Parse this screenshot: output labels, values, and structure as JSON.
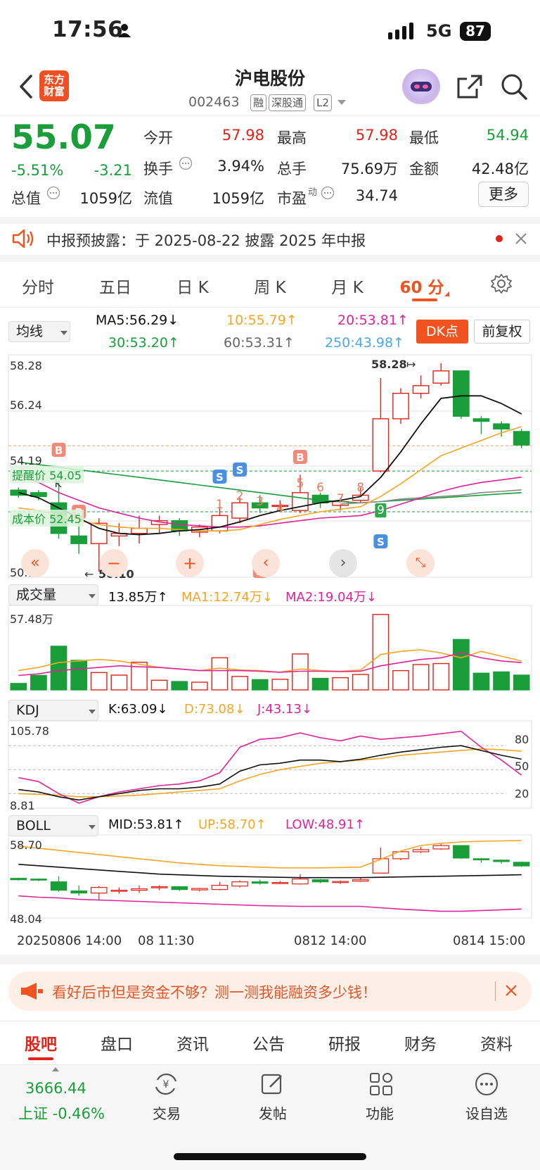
{
  "status": {
    "time": "17:56",
    "network": "5G",
    "battery": "87"
  },
  "header": {
    "title": "沪电股份",
    "code": "002463",
    "tags": [
      "融",
      "深股通",
      "L2"
    ],
    "logo_text": "东方财富"
  },
  "quote": {
    "price": "55.07",
    "change_pct": "-5.51%",
    "change": "-3.21",
    "stats": [
      {
        "label": "今开",
        "value": "57.98",
        "color": "red"
      },
      {
        "label": "最高",
        "value": "57.98",
        "color": "red"
      },
      {
        "label": "最低",
        "value": "54.94",
        "color": "green"
      },
      {
        "label": "换手",
        "value": "3.94%",
        "color": "normal"
      },
      {
        "label": "总手",
        "value": "75.69万",
        "color": "normal"
      },
      {
        "label": "金额",
        "value": "42.48亿",
        "color": "normal"
      },
      {
        "label": "总值",
        "value": "1059亿",
        "color": "normal"
      },
      {
        "label": "流值",
        "value": "1059亿",
        "color": "normal"
      },
      {
        "label": "市盈",
        "sup": "动",
        "value": "34.74",
        "color": "normal"
      }
    ],
    "more": "更多"
  },
  "notice": {
    "text": "中报预披露：于 2025-08-22 披露 2025 年中报"
  },
  "period_tabs": [
    "分时",
    "五日",
    "日 K",
    "周 K",
    "月 K",
    "60 分"
  ],
  "active_period": "60 分",
  "ma_row": {
    "select": "均线",
    "ma5": "MA5:56.29↓",
    "ma10": "10:55.79↑",
    "ma20": "20:53.81↑",
    "ma30": "30:53.20↑",
    "ma60": "60:53.31↑",
    "ma250": "250:43.98↑",
    "dk_button": "DK点",
    "adjust_button": "前复权"
  },
  "colors": {
    "up": "#e2231a",
    "down": "#1a9e3a",
    "accent": "#f0531f",
    "ma5": "#111111",
    "ma10": "#f5a623",
    "ma20": "#e0239a",
    "ma30": "#1a9e3a",
    "ma60": "#888888",
    "ma250": "#4aa8ee"
  },
  "kline": {
    "axis": [
      "58.28",
      "56.24",
      "54.19",
      "50.10"
    ],
    "high_mark": "58.28",
    "low_mark": "50.10",
    "alert_price": "提醒价 54.05",
    "cost_price": "成本价 52.45",
    "signal_numbers": [
      "1",
      "2",
      "3",
      "4",
      "5",
      "6",
      "7",
      "8",
      "9"
    ],
    "signal_b": "B",
    "signal_s": "S",
    "signal_k": "K"
  },
  "volume": {
    "select": "成交量",
    "value": "13.85万↑",
    "ma1": "MA1:12.74万↓",
    "ma2": "MA2:19.04万↓",
    "axis_max": "57.48万"
  },
  "kdj": {
    "select": "KDJ",
    "k": "K:63.09↓",
    "d": "D:73.08↓",
    "j": "J:43.13↓",
    "axis_max": "105.78",
    "axis_min": "8.81",
    "levels": [
      "80",
      "50",
      "20"
    ]
  },
  "boll": {
    "select": "BOLL",
    "mid": "MID:53.81↑",
    "up": "UP:58.70↑",
    "low": "LOW:48.91↑",
    "axis_max": "58.70",
    "axis_min": "48.04"
  },
  "time_axis": [
    "20250806 14:00",
    "08 11:30",
    "0812 14:00",
    "0814 15:00"
  ],
  "chart_data": {
    "type": "candlestick",
    "title": "",
    "xlabel": "",
    "ylabel": "",
    "ylim": [
      50.1,
      58.28
    ],
    "bars": [
      {
        "o": 53.3,
        "c": 53.1,
        "h": 53.4,
        "l": 53.0
      },
      {
        "o": 53.2,
        "c": 53.05,
        "h": 53.3,
        "l": 52.9
      },
      {
        "o": 52.8,
        "c": 51.6,
        "h": 53.6,
        "l": 51.4
      },
      {
        "o": 51.5,
        "c": 51.2,
        "h": 52.3,
        "l": 50.8
      },
      {
        "o": 51.2,
        "c": 52.0,
        "h": 52.2,
        "l": 50.1
      },
      {
        "o": 51.5,
        "c": 51.6,
        "h": 52.0,
        "l": 51.1
      },
      {
        "o": 51.6,
        "c": 51.8,
        "h": 52.3,
        "l": 51.2
      },
      {
        "o": 51.95,
        "c": 52.1,
        "h": 52.3,
        "l": 51.6
      },
      {
        "o": 52.1,
        "c": 51.7,
        "h": 52.2,
        "l": 51.5
      },
      {
        "o": 51.65,
        "c": 51.85,
        "h": 51.95,
        "l": 51.45
      },
      {
        "o": 51.7,
        "c": 52.3,
        "h": 52.8,
        "l": 51.6
      },
      {
        "o": 52.2,
        "c": 52.8,
        "h": 53.0,
        "l": 52.0
      },
      {
        "o": 52.8,
        "c": 52.6,
        "h": 53.1,
        "l": 52.4
      },
      {
        "o": 52.7,
        "c": 52.7,
        "h": 52.9,
        "l": 52.5
      },
      {
        "o": 52.5,
        "c": 53.2,
        "h": 53.9,
        "l": 52.4
      },
      {
        "o": 53.1,
        "c": 52.8,
        "h": 53.2,
        "l": 52.6
      },
      {
        "o": 52.7,
        "c": 52.85,
        "h": 53.0,
        "l": 52.5
      },
      {
        "o": 52.9,
        "c": 53.1,
        "h": 53.4,
        "l": 52.8
      },
      {
        "o": 54.05,
        "c": 56.1,
        "h": 57.7,
        "l": 54.0
      },
      {
        "o": 56.1,
        "c": 57.1,
        "h": 57.3,
        "l": 55.9
      },
      {
        "o": 57.1,
        "c": 57.4,
        "h": 57.8,
        "l": 56.9
      },
      {
        "o": 57.5,
        "c": 57.98,
        "h": 58.28,
        "l": 57.4
      },
      {
        "o": 57.98,
        "c": 56.2,
        "h": 57.98,
        "l": 56.1
      },
      {
        "o": 56.1,
        "c": 56.0,
        "h": 56.2,
        "l": 55.5
      },
      {
        "o": 55.9,
        "c": 55.7,
        "h": 56.0,
        "l": 55.4
      },
      {
        "o": 55.6,
        "c": 55.07,
        "h": 55.7,
        "l": 54.94
      }
    ],
    "ma5": [
      53.2,
      53.0,
      52.6,
      52.2,
      51.8,
      51.6,
      51.55,
      51.6,
      51.7,
      51.75,
      51.85,
      52.05,
      52.3,
      52.5,
      52.65,
      52.8,
      52.9,
      53.05,
      53.8,
      54.8,
      55.9,
      56.9,
      57.0,
      57.0,
      56.7,
      56.29
    ],
    "ma10": [
      52.6,
      52.5,
      52.3,
      52.1,
      51.95,
      51.85,
      51.8,
      51.8,
      51.75,
      51.7,
      51.7,
      51.75,
      51.95,
      52.15,
      52.3,
      52.45,
      52.55,
      52.65,
      53.05,
      53.55,
      54.1,
      54.65,
      54.95,
      55.25,
      55.55,
      55.79
    ],
    "ma20": [
      53.9,
      53.6,
      53.2,
      52.9,
      52.6,
      52.4,
      52.2,
      52.05,
      51.95,
      51.9,
      51.85,
      51.85,
      51.9,
      52.0,
      52.1,
      52.2,
      52.25,
      52.3,
      52.5,
      52.75,
      53.0,
      53.25,
      53.45,
      53.6,
      53.7,
      53.81
    ],
    "ma30": [
      54.4,
      54.3,
      54.2,
      54.1,
      54.0,
      53.9,
      53.8,
      53.7,
      53.6,
      53.5,
      53.4,
      53.3,
      53.2,
      53.1,
      53.0,
      52.9,
      52.85,
      52.8,
      52.85,
      52.9,
      52.95,
      53.0,
      53.05,
      53.1,
      53.15,
      53.2
    ],
    "ma60": [
      null,
      null,
      null,
      null,
      null,
      null,
      null,
      null,
      null,
      null,
      null,
      null,
      null,
      null,
      null,
      null,
      52.75,
      52.8,
      52.85,
      52.95,
      53.0,
      53.05,
      53.1,
      53.2,
      53.25,
      53.31
    ],
    "volume": [
      2.0,
      4.5,
      13.6,
      9.2,
      5.4,
      4.6,
      8.6,
      3.0,
      2.6,
      2.4,
      10.0,
      4.2,
      3.2,
      3.3,
      11.2,
      3.6,
      3.8,
      4.8,
      23.5,
      6.0,
      7.9,
      8.2,
      15.7,
      5.2,
      5.6,
      4.6
    ],
    "volume_ma1": [
      6.0,
      7.0,
      8.5,
      9.0,
      9.5,
      9.0,
      8.0,
      7.0,
      6.5,
      6.0,
      6.8,
      6.2,
      6.0,
      5.5,
      6.5,
      6.0,
      5.8,
      6.2,
      11.0,
      12.0,
      12.5,
      11.5,
      10.0,
      12.0,
      10.5,
      9.0
    ],
    "volume_ma2": [
      4.5,
      5.0,
      6.0,
      6.5,
      7.0,
      7.5,
      7.2,
      7.0,
      6.5,
      6.0,
      6.0,
      6.0,
      5.8,
      5.5,
      5.8,
      5.8,
      5.7,
      5.8,
      7.5,
      8.5,
      9.5,
      10.0,
      11.5,
      10.0,
      9.0,
      8.5
    ],
    "kdj_k": [
      25,
      22,
      16,
      12,
      16,
      20,
      24,
      26,
      26,
      28,
      32,
      48,
      56,
      58,
      62,
      62,
      60,
      63,
      68,
      72,
      75,
      78,
      80,
      74,
      68,
      63.09
    ],
    "kdj_d": [
      20,
      19,
      18,
      16,
      16,
      17,
      18,
      20,
      22,
      24,
      26,
      36,
      44,
      50,
      54,
      58,
      60,
      62,
      64,
      68,
      70,
      72,
      74,
      76,
      75,
      73.08
    ],
    "kdj_j": [
      40,
      35,
      20,
      8,
      16,
      22,
      26,
      30,
      32,
      36,
      46,
      78,
      88,
      90,
      96,
      90,
      86,
      92,
      88,
      90,
      92,
      95,
      98,
      78,
      62,
      43.13
    ],
    "boll_up": [
      57.9,
      57.6,
      57.3,
      57.0,
      56.7,
      56.4,
      56.1,
      55.8,
      55.5,
      55.3,
      55.1,
      55.0,
      54.9,
      54.8,
      54.8,
      54.8,
      54.85,
      54.9,
      56.0,
      57.2,
      58.0,
      58.3,
      58.5,
      58.6,
      58.65,
      58.7
    ],
    "boll_mid": [
      55.3,
      55.1,
      54.9,
      54.7,
      54.5,
      54.3,
      54.1,
      53.9,
      53.8,
      53.7,
      53.6,
      53.55,
      53.5,
      53.45,
      53.4,
      53.4,
      53.4,
      53.4,
      53.45,
      53.5,
      53.55,
      53.6,
      53.65,
      53.7,
      53.75,
      53.81
    ],
    "boll_low": [
      50.8,
      50.6,
      50.5,
      50.3,
      50.2,
      50.1,
      50.0,
      49.9,
      49.8,
      49.7,
      49.6,
      49.5,
      49.4,
      49.35,
      49.3,
      49.3,
      49.3,
      49.3,
      49.1,
      48.9,
      48.75,
      48.6,
      48.6,
      48.7,
      48.8,
      48.91
    ],
    "kdj_ylim": [
      8.81,
      105.78
    ],
    "boll_ylim": [
      48.04,
      58.7
    ],
    "volume_ylim": [
      0,
      57.48
    ]
  },
  "ad": {
    "text": "看好后市但是资金不够？测一测我能融资多少钱！"
  },
  "bottom_tabs": [
    "股吧",
    "盘口",
    "资讯",
    "公告",
    "研报",
    "财务",
    "资料"
  ],
  "active_bottom_tab": "股吧",
  "dock": {
    "index_value": "3666.44",
    "index_name": "上证 -0.46%",
    "items": [
      {
        "label": "交易",
        "icon": "yen-exchange-icon"
      },
      {
        "label": "发帖",
        "icon": "edit-post-icon"
      },
      {
        "label": "功能",
        "icon": "grid-apps-icon"
      },
      {
        "label": "设自选",
        "icon": "more-dots-icon"
      }
    ]
  }
}
